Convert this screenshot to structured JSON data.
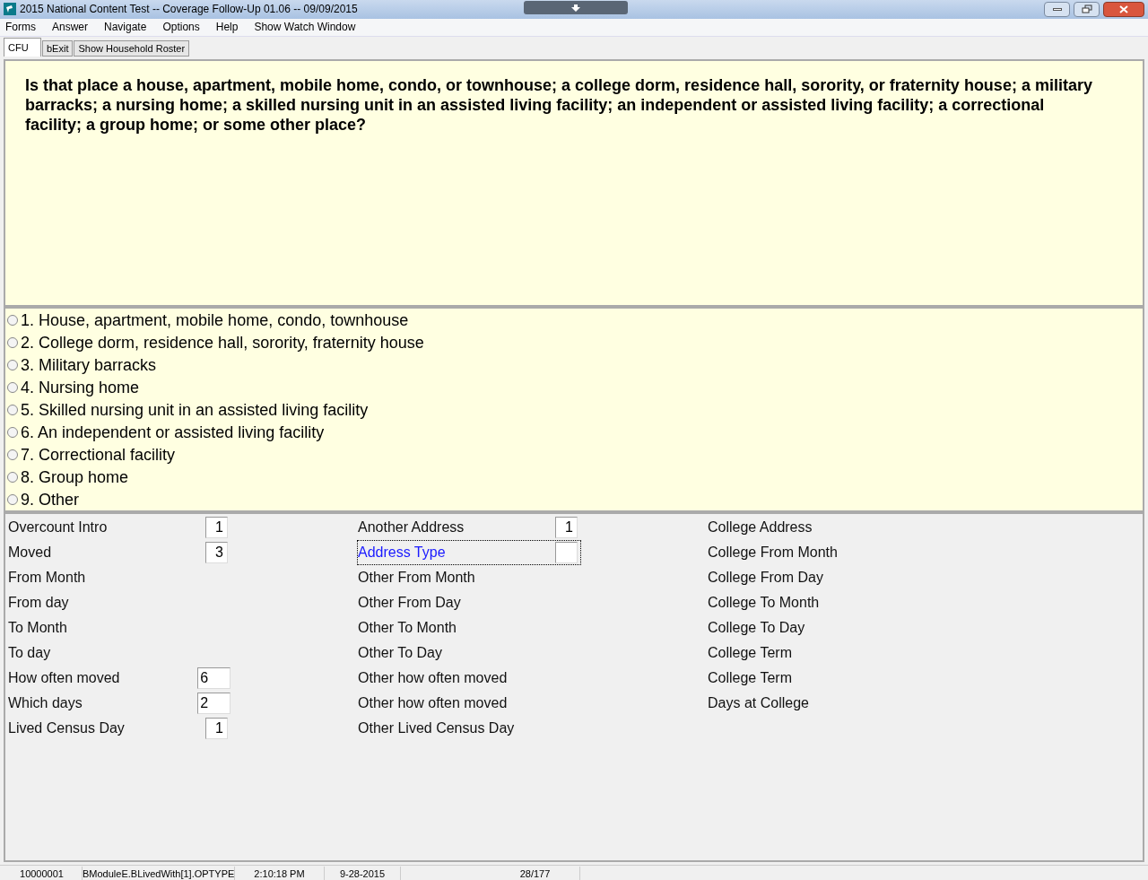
{
  "window": {
    "title": "2015 National Content Test -- Coverage Follow-Up 01.06 -- 09/09/2015"
  },
  "menu": [
    "Forms",
    "Answer",
    "Navigate",
    "Options",
    "Help",
    "Show Watch Window"
  ],
  "tabs": [
    {
      "label": "CFU",
      "selected": true
    },
    {
      "label": "bExit",
      "selected": false
    },
    {
      "label": "Show Household Roster",
      "selected": false
    }
  ],
  "question": "Is that place a house, apartment, mobile home, condo, or townhouse; a college dorm, residence hall, sorority, or fraternity house; a military barracks; a nursing home; a skilled nursing unit in an assisted living facility; an independent or assisted living facility; a correctional facility; a group home; or some other place?",
  "answers": [
    {
      "label": "1. House, apartment, mobile home, condo, townhouse",
      "selected": false
    },
    {
      "label": "2. College dorm, residence hall, sorority, fraternity house",
      "selected": false
    },
    {
      "label": "3. Military barracks",
      "selected": false
    },
    {
      "label": "4. Nursing home",
      "selected": false
    },
    {
      "label": "5. Skilled nursing unit in an assisted living facility",
      "selected": false
    },
    {
      "label": "6. An independent or assisted living facility",
      "selected": false
    },
    {
      "label": "7. Correctional facility",
      "selected": false
    },
    {
      "label": "8. Group home",
      "selected": false
    },
    {
      "label": "9. Other",
      "selected": false
    }
  ],
  "field_columns": [
    [
      {
        "label": "Overcount Intro",
        "kind": "narrow",
        "value": "1",
        "focused": false
      },
      {
        "label": "Moved",
        "kind": "narrow",
        "value": "3",
        "focused": false
      },
      {
        "label": "From Month",
        "kind": "none",
        "focused": false
      },
      {
        "label": "From day",
        "kind": "none",
        "focused": false
      },
      {
        "label": "To Month",
        "kind": "none",
        "focused": false
      },
      {
        "label": "To day",
        "kind": "none",
        "focused": false
      },
      {
        "label": "How often moved",
        "kind": "wide",
        "value": "6",
        "focused": false
      },
      {
        "label": "Which days",
        "kind": "wide",
        "value": "2",
        "focused": false
      },
      {
        "label": "Lived Census Day",
        "kind": "narrow",
        "value": "1",
        "focused": false
      }
    ],
    [
      {
        "label": "Another Address",
        "kind": "narrow",
        "value": "1",
        "focused": false
      },
      {
        "label": "Address Type",
        "kind": "narrow",
        "focused": true
      },
      {
        "label": "Other From Month",
        "kind": "none",
        "focused": false
      },
      {
        "label": "Other From Day",
        "kind": "none",
        "focused": false
      },
      {
        "label": "Other To Month",
        "kind": "none",
        "focused": false
      },
      {
        "label": "Other To Day",
        "kind": "none",
        "focused": false
      },
      {
        "label": "Other how often moved",
        "kind": "none",
        "focused": false
      },
      {
        "label": "Other how often moved",
        "kind": "none",
        "focused": false
      },
      {
        "label": "Other Lived Census Day",
        "kind": "none",
        "focused": false
      }
    ],
    [
      {
        "label": "College Address",
        "kind": "none",
        "focused": false
      },
      {
        "label": "College From Month",
        "kind": "none",
        "focused": false
      },
      {
        "label": "College From Day",
        "kind": "none",
        "focused": false
      },
      {
        "label": "College To Month",
        "kind": "none",
        "focused": false
      },
      {
        "label": "College To Day",
        "kind": "none",
        "focused": false
      },
      {
        "label": "College Term",
        "kind": "none",
        "focused": false
      },
      {
        "label": "College Term",
        "kind": "none",
        "focused": false
      },
      {
        "label": "Days at College",
        "kind": "none",
        "focused": false
      }
    ]
  ],
  "status_bar": [
    "10000001",
    "BModuleE.BLivedWith[1].OPTYPE",
    "2:10:18 PM",
    "9-28-2015",
    "28/177"
  ]
}
